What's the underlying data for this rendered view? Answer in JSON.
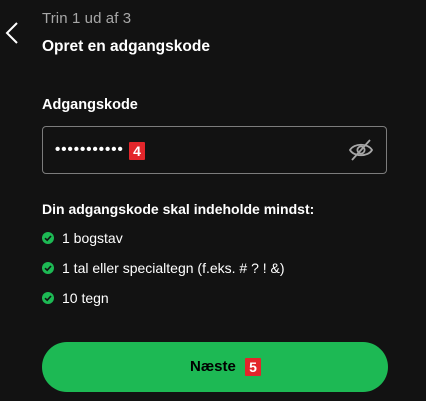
{
  "header": {
    "step_text": "Trin 1 ud af 3",
    "title": "Opret en adgangskode"
  },
  "password": {
    "label": "Adgangskode",
    "masked_value": "•••••••••••",
    "badge": "4"
  },
  "requirements": {
    "title": "Din adgangskode skal indeholde mindst:",
    "items": [
      {
        "text": "1 bogstav",
        "met": true
      },
      {
        "text": "1 tal eller specialtegn (f.eks. # ? ! &)",
        "met": true
      },
      {
        "text": "10 tegn",
        "met": true
      }
    ]
  },
  "next_button": {
    "label": "Næste",
    "badge": "5"
  },
  "colors": {
    "background": "#121212",
    "accent": "#1db954",
    "badge": "#e3262b",
    "muted_text": "#a7a7a7"
  },
  "icons": {
    "back": "chevron-left-icon",
    "toggle_visibility": "eye-slash-icon",
    "check": "check-circle-icon"
  }
}
